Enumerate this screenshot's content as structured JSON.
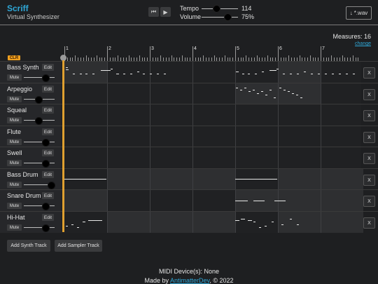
{
  "header": {
    "title": "Scriff",
    "subtitle": "Virtual Synthesizer",
    "transport": {
      "skip_back_icon": "skip-back-icon",
      "play_icon": "play-icon"
    },
    "tempo": {
      "label": "Tempo",
      "value": "114"
    },
    "volume": {
      "label": "Volume",
      "value": "75%"
    },
    "download": {
      "label": "*.wav",
      "icon": "download-arrow-icon"
    }
  },
  "measures": {
    "label": "Measures: 16",
    "change": "change"
  },
  "ruler": {
    "numbers": [
      "1",
      "2",
      "3",
      "4",
      "5",
      "6",
      "7"
    ],
    "clear": "CLR"
  },
  "tracks": [
    {
      "name": "Bass Synth",
      "edit": "Edit",
      "mute": "Mute",
      "remove": "X"
    },
    {
      "name": "Arpeggio",
      "edit": "Edit",
      "mute": "Mute",
      "remove": "X"
    },
    {
      "name": "Squeal",
      "edit": "Edit",
      "mute": "Mute",
      "remove": "X"
    },
    {
      "name": "Flute",
      "edit": "Edit",
      "mute": "Mute",
      "remove": "X"
    },
    {
      "name": "Swell",
      "edit": "Edit",
      "mute": "Mute",
      "remove": "X"
    },
    {
      "name": "Bass Drum",
      "edit": "Edit",
      "mute": "Mute",
      "remove": "X"
    },
    {
      "name": "Snare Drum",
      "edit": "Edit",
      "mute": "Mute",
      "remove": "X"
    },
    {
      "name": "Hi-Hat",
      "edit": "Edit",
      "mute": "Mute",
      "remove": "X"
    }
  ],
  "add_buttons": {
    "synth": "Add Synth Track",
    "sampler": "Add Sampler Track"
  },
  "footer": {
    "midi": "MIDI Device(s): None",
    "made_by_prefix": "Made by ",
    "author": "AntimatterDev",
    "made_by_suffix": ", © 2022"
  }
}
